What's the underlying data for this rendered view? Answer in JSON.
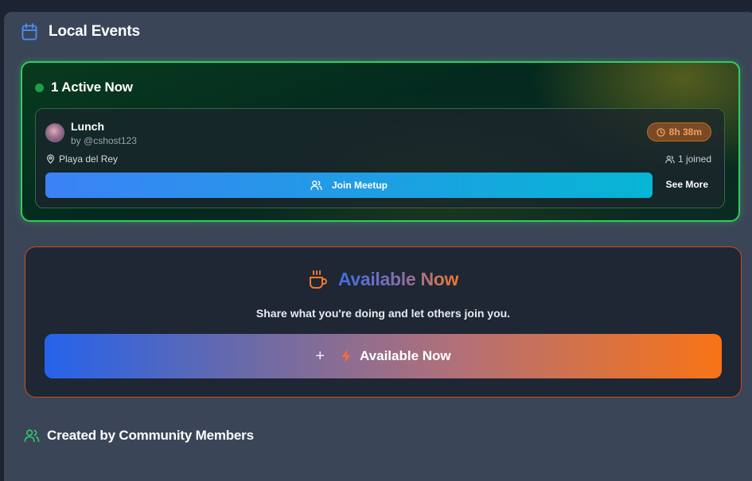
{
  "local_events": {
    "title": "Local Events",
    "icon": "calendar-icon"
  },
  "active": {
    "title": "1 Active Now",
    "event": {
      "title": "Lunch",
      "by": "by @cshost123",
      "time_left": "8h 38m",
      "location": "Playa del Rey",
      "joined": "1 joined",
      "join_label": "Join Meetup",
      "see_more_label": "See More"
    }
  },
  "available": {
    "title": "Available Now",
    "subtitle": "Share what you're doing and let others join you.",
    "button_plus": "+",
    "button_label": "Available Now"
  },
  "community": {
    "title": "Created by Community Members",
    "icon": "users-icon"
  },
  "colors": {
    "active_border": "#2fcf5e",
    "available_border": "#c2521c",
    "accent_blue": "#3b82f6",
    "accent_orange": "#f97316"
  }
}
